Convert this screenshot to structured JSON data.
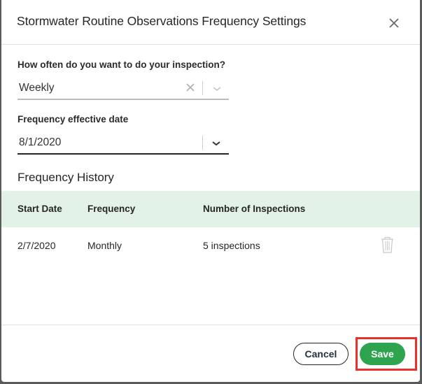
{
  "dialog": {
    "title": "Stormwater Routine Observations Frequency Settings",
    "close_icon": "close-icon"
  },
  "form": {
    "frequency": {
      "label": "How often do you want to do your inspection?",
      "value": "Weekly"
    },
    "effective_date": {
      "label": "Frequency effective date",
      "value": "8/1/2020"
    }
  },
  "history": {
    "title": "Frequency History",
    "columns": [
      "Start Date",
      "Frequency",
      "Number of Inspections"
    ],
    "rows": [
      {
        "start_date": "2/7/2020",
        "frequency": "Monthly",
        "inspections": "5 inspections"
      }
    ]
  },
  "footer": {
    "cancel_label": "Cancel",
    "save_label": "Save"
  },
  "colors": {
    "accent": "#2ea44f",
    "table_header_bg": "#e2f2e7",
    "highlight": "#e8322a"
  }
}
